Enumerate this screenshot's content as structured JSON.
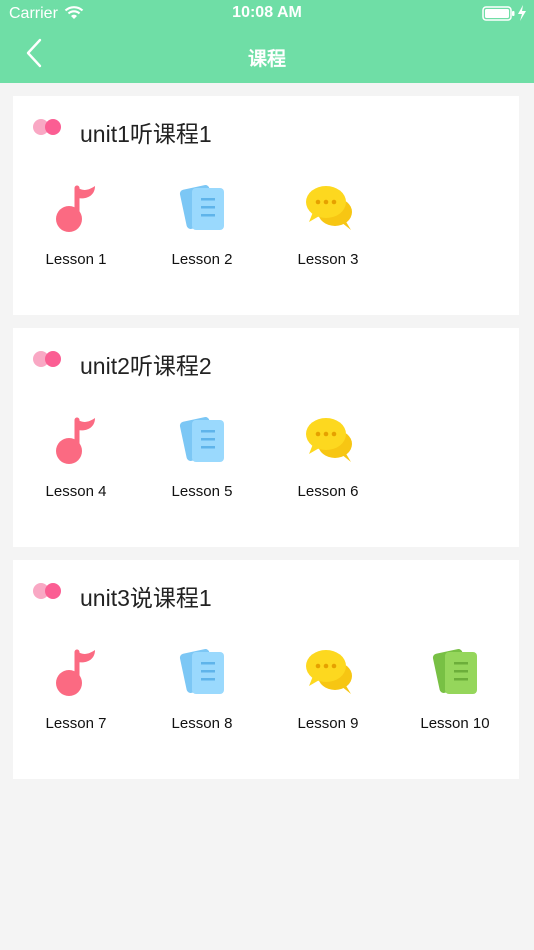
{
  "status_bar": {
    "carrier": "Carrier",
    "time": "10:08 AM"
  },
  "nav": {
    "title": "课程"
  },
  "colors": {
    "header": "#6fdea6",
    "music": "#fb6a82",
    "doc": "#8ed3fb",
    "chat": "#fdd319",
    "green_doc": "#8bd35a"
  },
  "units": [
    {
      "title": "unit1听课程1",
      "lessons": [
        {
          "label": "Lesson 1",
          "icon": "music-note-icon"
        },
        {
          "label": "Lesson 2",
          "icon": "document-icon"
        },
        {
          "label": "Lesson 3",
          "icon": "chat-bubble-icon"
        }
      ]
    },
    {
      "title": "unit2听课程2",
      "lessons": [
        {
          "label": "Lesson 4",
          "icon": "music-note-icon"
        },
        {
          "label": "Lesson 5",
          "icon": "document-icon"
        },
        {
          "label": "Lesson 6",
          "icon": "chat-bubble-icon"
        }
      ]
    },
    {
      "title": "unit3说课程1",
      "lessons": [
        {
          "label": "Lesson 7",
          "icon": "music-note-icon"
        },
        {
          "label": "Lesson 8",
          "icon": "document-icon"
        },
        {
          "label": "Lesson 9",
          "icon": "chat-bubble-icon"
        },
        {
          "label": "Lesson 10",
          "icon": "green-document-icon"
        }
      ]
    }
  ]
}
